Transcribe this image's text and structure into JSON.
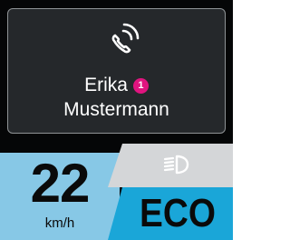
{
  "call": {
    "icon": "phone-ringing-icon",
    "caller_first": "Erika",
    "caller_last": "Mustermann",
    "badge_count": "1",
    "badge_color": "#e0147f"
  },
  "speed": {
    "value": "22",
    "unit": "km/h"
  },
  "lights": {
    "icon": "low-beam-headlight-icon"
  },
  "drive_mode": {
    "label": "ECO",
    "color": "#1aa6d8"
  },
  "colors": {
    "speed_panel": "#87c8e6",
    "headlight_panel": "#d4d6d8",
    "card_background": "#25282b",
    "card_border": "#8f9396"
  }
}
